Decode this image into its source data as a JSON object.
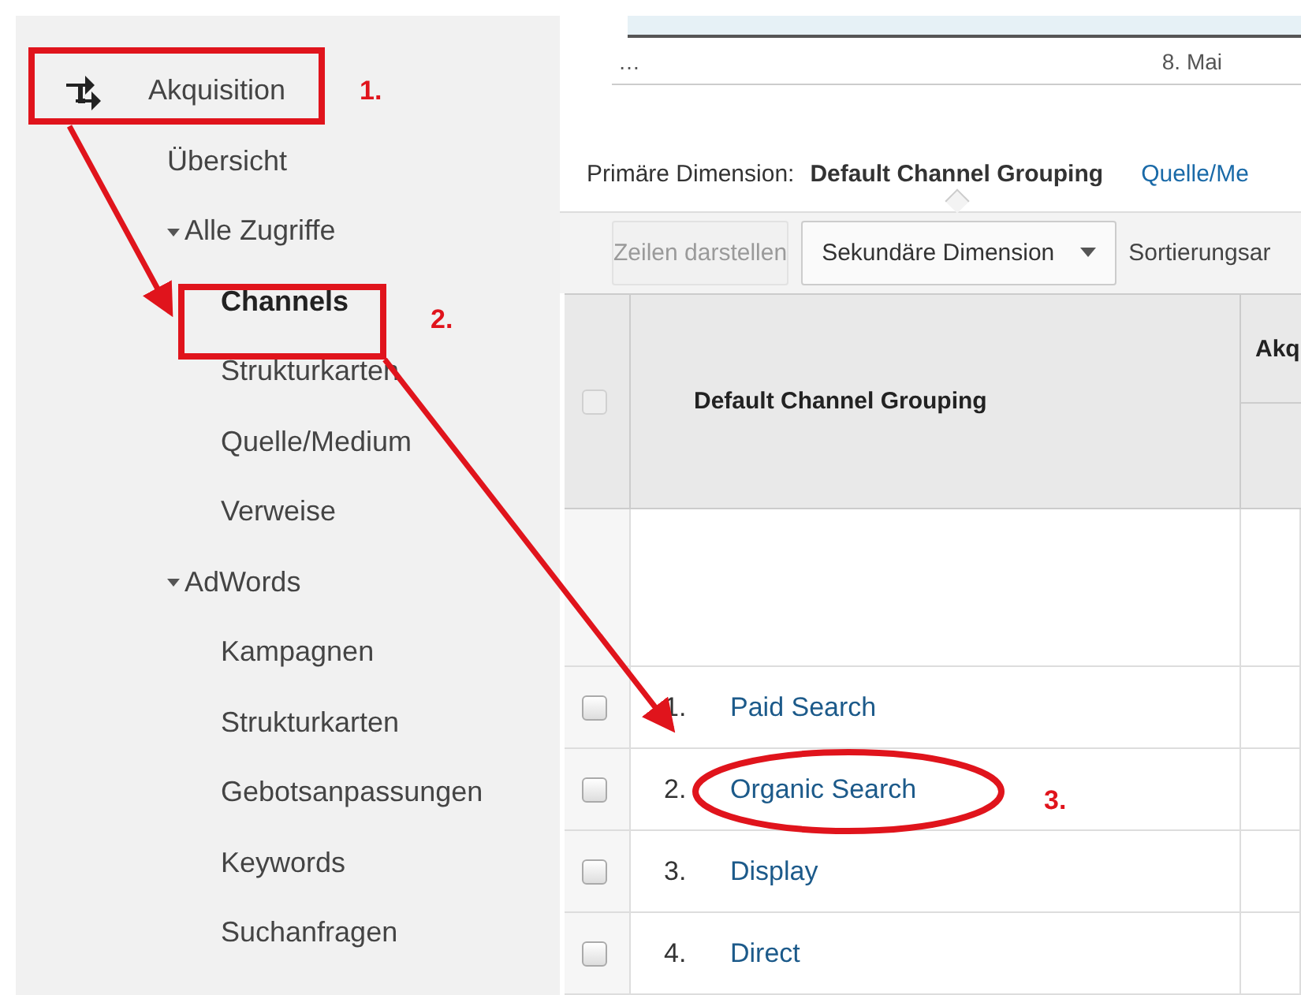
{
  "sidebar": {
    "items": [
      {
        "label": "Akquisition",
        "selected": false,
        "children": [
          {
            "label": "Übersicht",
            "selected": false
          },
          {
            "label": "Alle Zugriffe",
            "selected": false,
            "expanded": true,
            "children": [
              {
                "label": "Channels",
                "selected": true
              },
              {
                "label": "Strukturkarten",
                "selected": false
              },
              {
                "label": "Quelle/Medium",
                "selected": false
              },
              {
                "label": "Verweise",
                "selected": false
              }
            ]
          },
          {
            "label": "AdWords",
            "selected": false,
            "expanded": true,
            "children": [
              {
                "label": "Kampagnen",
                "selected": false
              },
              {
                "label": "Strukturkarten",
                "selected": false
              },
              {
                "label": "Gebotsanpassungen",
                "selected": false
              },
              {
                "label": "Keywords",
                "selected": false
              },
              {
                "label": "Suchanfragen",
                "selected": false
              }
            ]
          }
        ]
      }
    ]
  },
  "timeline": {
    "start_label": "…",
    "date_label": "8. Mai"
  },
  "primary_dimension": {
    "label": "Primäre Dimension:",
    "options": [
      {
        "label": "Default Channel Grouping",
        "selected": true
      },
      {
        "label": "Quelle/Me",
        "selected": false
      }
    ]
  },
  "toolbar": {
    "plot_rows_button": {
      "label": "Zeilen darstellen",
      "disabled": true
    },
    "secondary_dimension": "Sekundäre Dimension",
    "sort_label": "Sortierungsar"
  },
  "table": {
    "all_checked": false,
    "columns": [
      "Default Channel Grouping",
      "Akq"
    ],
    "rows": [
      {
        "index": "1.",
        "channel": "Paid Search",
        "checked": false
      },
      {
        "index": "2.",
        "channel": "Organic Search",
        "checked": false
      },
      {
        "index": "3.",
        "channel": "Display",
        "checked": false
      },
      {
        "index": "4.",
        "channel": "Direct",
        "checked": false
      }
    ]
  },
  "annotations": {
    "step_labels": [
      "1.",
      "2.",
      "3."
    ]
  }
}
